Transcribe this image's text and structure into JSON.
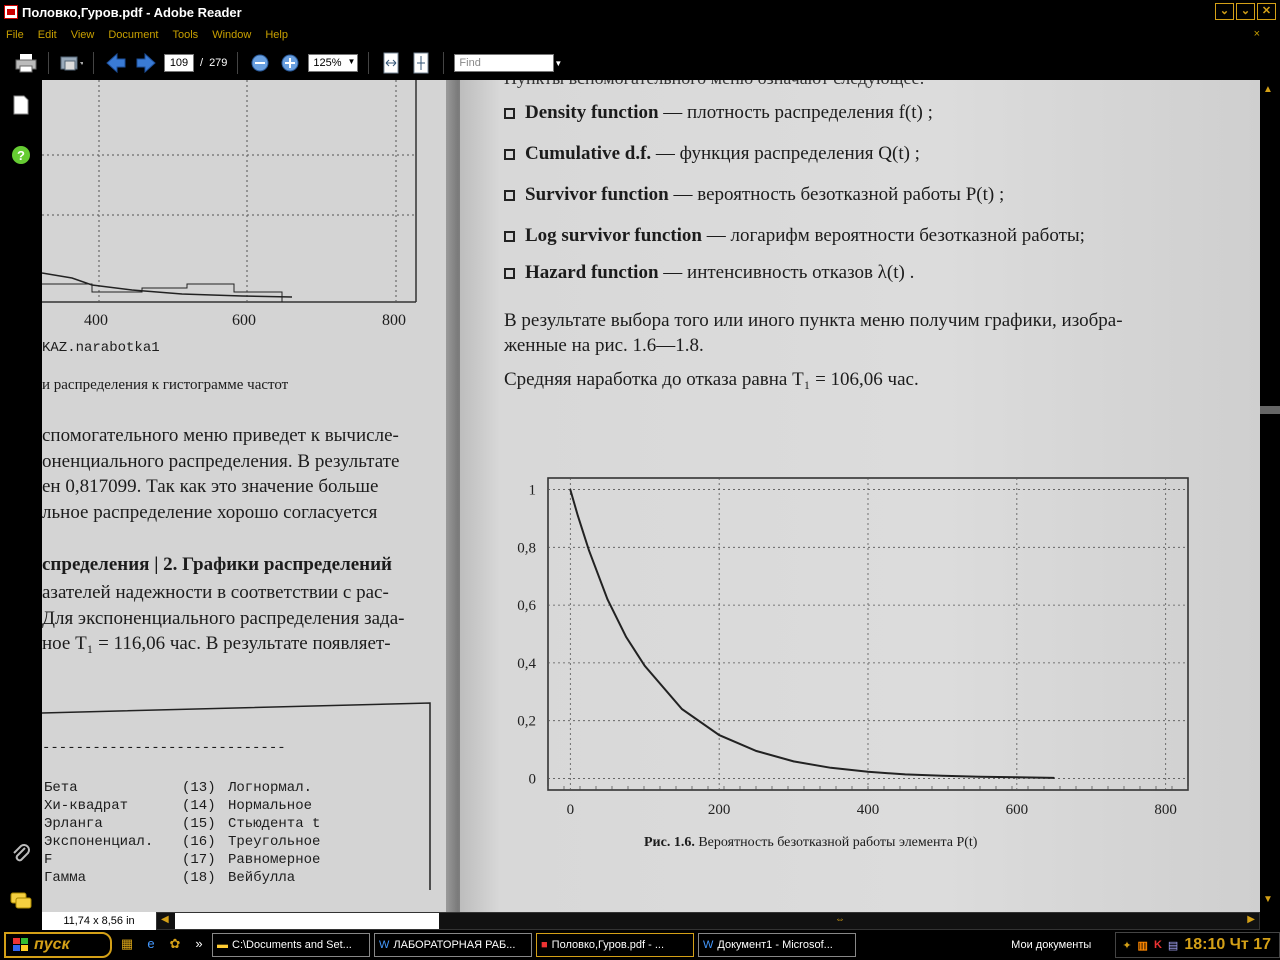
{
  "window": {
    "title": "Половко,Гуров.pdf - Adobe Reader",
    "btn_min": "⌄",
    "btn_max": "⌄",
    "btn_close": "✕"
  },
  "menu": {
    "items": [
      "File",
      "Edit",
      "View",
      "Document",
      "Tools",
      "Window",
      "Help"
    ],
    "close": "×"
  },
  "toolbar": {
    "page_current": "109",
    "page_sep": "/",
    "page_total": "279",
    "zoom": "125%",
    "find_placeholder": "Find"
  },
  "status": {
    "page_size": "11,74 x 8,56 in"
  },
  "left_page": {
    "axis_ticks": [
      "400",
      "600",
      "800"
    ],
    "fig_label": "KAZ.narabotka1",
    "caption": "и распределения к гистограмме частот",
    "para": [
      "спомогательного меню приведет к вычисле-",
      "оненциального распределения. В результате",
      "ен 0,817099. Так как это значение больше",
      "льное распределение хорошо согласуется"
    ],
    "heading": "спределения | 2. Графики распределений",
    "para2": [
      "азателей надежности в соответствии с рас-",
      "Для экспоненциального распределения зада-",
      "ное  T₁ = 116,06  час. В результате появляет-"
    ],
    "dashes": "-----------------------------",
    "list": [
      [
        "Бета",
        "(13)",
        "Логнормал."
      ],
      [
        "Хи-квадрат",
        "(14)",
        "Нормальное"
      ],
      [
        "Эрланга",
        "(15)",
        "Стьюдента t"
      ],
      [
        "Экспоненциал.",
        "(16)",
        "Треугольное"
      ],
      [
        "F",
        "(17)",
        "Равномерное"
      ],
      [
        "Гамма",
        "(18)",
        "Вейбулла"
      ]
    ]
  },
  "right_page": {
    "top_cut": "Пункты вспомогательного меню означают следующее:",
    "bullets": [
      {
        "term": "Density function",
        "desc": "— плотность распределения  f(t) ;"
      },
      {
        "term": "Cumulative d.f.",
        "desc": "— функция распределения  Q(t) ;"
      },
      {
        "term": "Survivor function",
        "desc": "— вероятность безотказной работы  P(t) ;"
      },
      {
        "term": "Log survivor function",
        "desc": "— логарифм вероятности безотказной работы;"
      },
      {
        "term": "Hazard function",
        "desc": "— интенсивность отказов  λ(t) ."
      }
    ],
    "para": [
      "В результате выбора того или иного пункта меню получим графики, изобра-",
      "женные на рис. 1.6—1.8."
    ],
    "mean_line": "Средняя наработка до отказа равна  T₁ = 106,06  час.",
    "caption_bold": "Рис. 1.6.",
    "caption_rest": "Вероятность безотказной работы элемента P(t)"
  },
  "chart_data": {
    "type": "line",
    "x": [
      0,
      10,
      25,
      50,
      75,
      100,
      150,
      200,
      250,
      300,
      350,
      400,
      450,
      500,
      550,
      600,
      650
    ],
    "series": [
      {
        "values": [
          1.0,
          0.91,
          0.79,
          0.62,
          0.49,
          0.39,
          0.24,
          0.15,
          0.095,
          0.059,
          0.037,
          0.023,
          0.014,
          0.009,
          0.006,
          0.004,
          0.002
        ]
      }
    ],
    "xticks": [
      "0",
      "200",
      "400",
      "600",
      "800"
    ],
    "yticks": [
      "0",
      "0,2",
      "0,4",
      "0,6",
      "0,8",
      "1"
    ],
    "xlim": [
      -30,
      830
    ],
    "ylim": [
      -0.04,
      1.04
    ],
    "grid": true
  },
  "taskbar": {
    "start": "пуск",
    "tasks": [
      "C:\\Documents and Set...",
      "ЛАБОРАТОРНАЯ РАБ...",
      "Половко,Гуров.pdf - ...",
      "Документ1 - Microsof..."
    ],
    "my_docs": "Мои документы",
    "clock": "18:10 Чт 17"
  }
}
